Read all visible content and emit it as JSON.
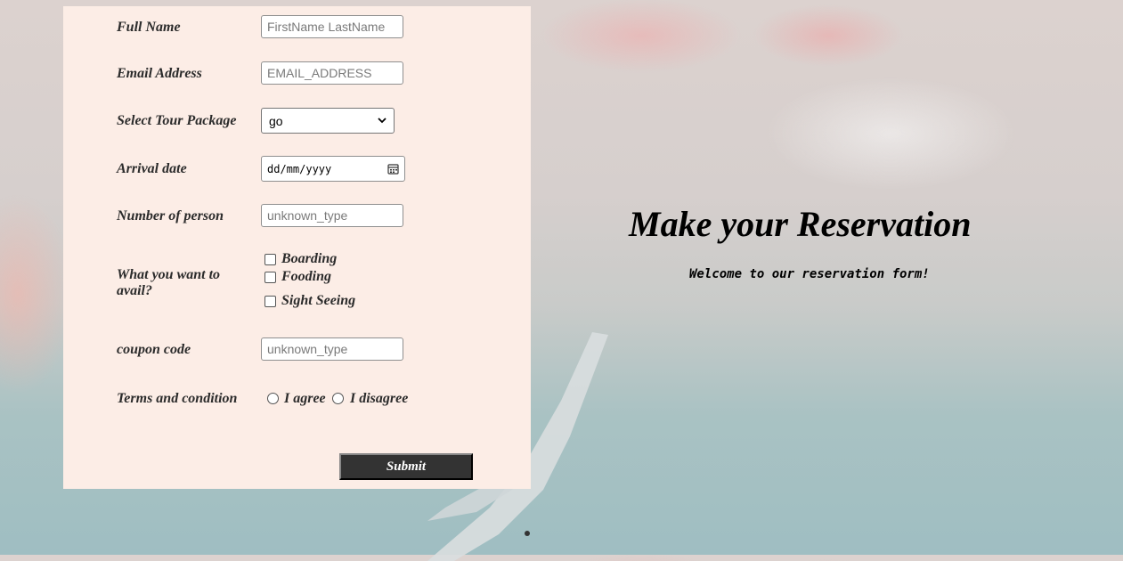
{
  "form": {
    "full_name": {
      "label": "Full Name",
      "placeholder": "FirstName LastName"
    },
    "email": {
      "label": "Email Address",
      "placeholder": "EMAIL_ADDRESS"
    },
    "tour_package": {
      "label": "Select Tour Package",
      "selected": "go"
    },
    "arrival_date": {
      "label": "Arrival date",
      "placeholder": "dd/mm/yyyy",
      "icon": "calendar-icon"
    },
    "persons": {
      "label": "Number of person",
      "placeholder": "unknown_type"
    },
    "avail": {
      "label": "What you want to avail?",
      "options": [
        "Boarding",
        "Fooding",
        "Sight Seeing"
      ]
    },
    "coupon": {
      "label": "coupon code",
      "placeholder": "unknown_type"
    },
    "terms": {
      "label": "Terms and condition",
      "agree": "I agree",
      "disagree": "I disagree"
    },
    "submit_label": "Submit"
  },
  "hero": {
    "title": "Make your Reservation",
    "subtitle": "Welcome to our reservation form!"
  },
  "colors": {
    "panel_bg": "#fcede6",
    "button_bg": "#333333"
  }
}
